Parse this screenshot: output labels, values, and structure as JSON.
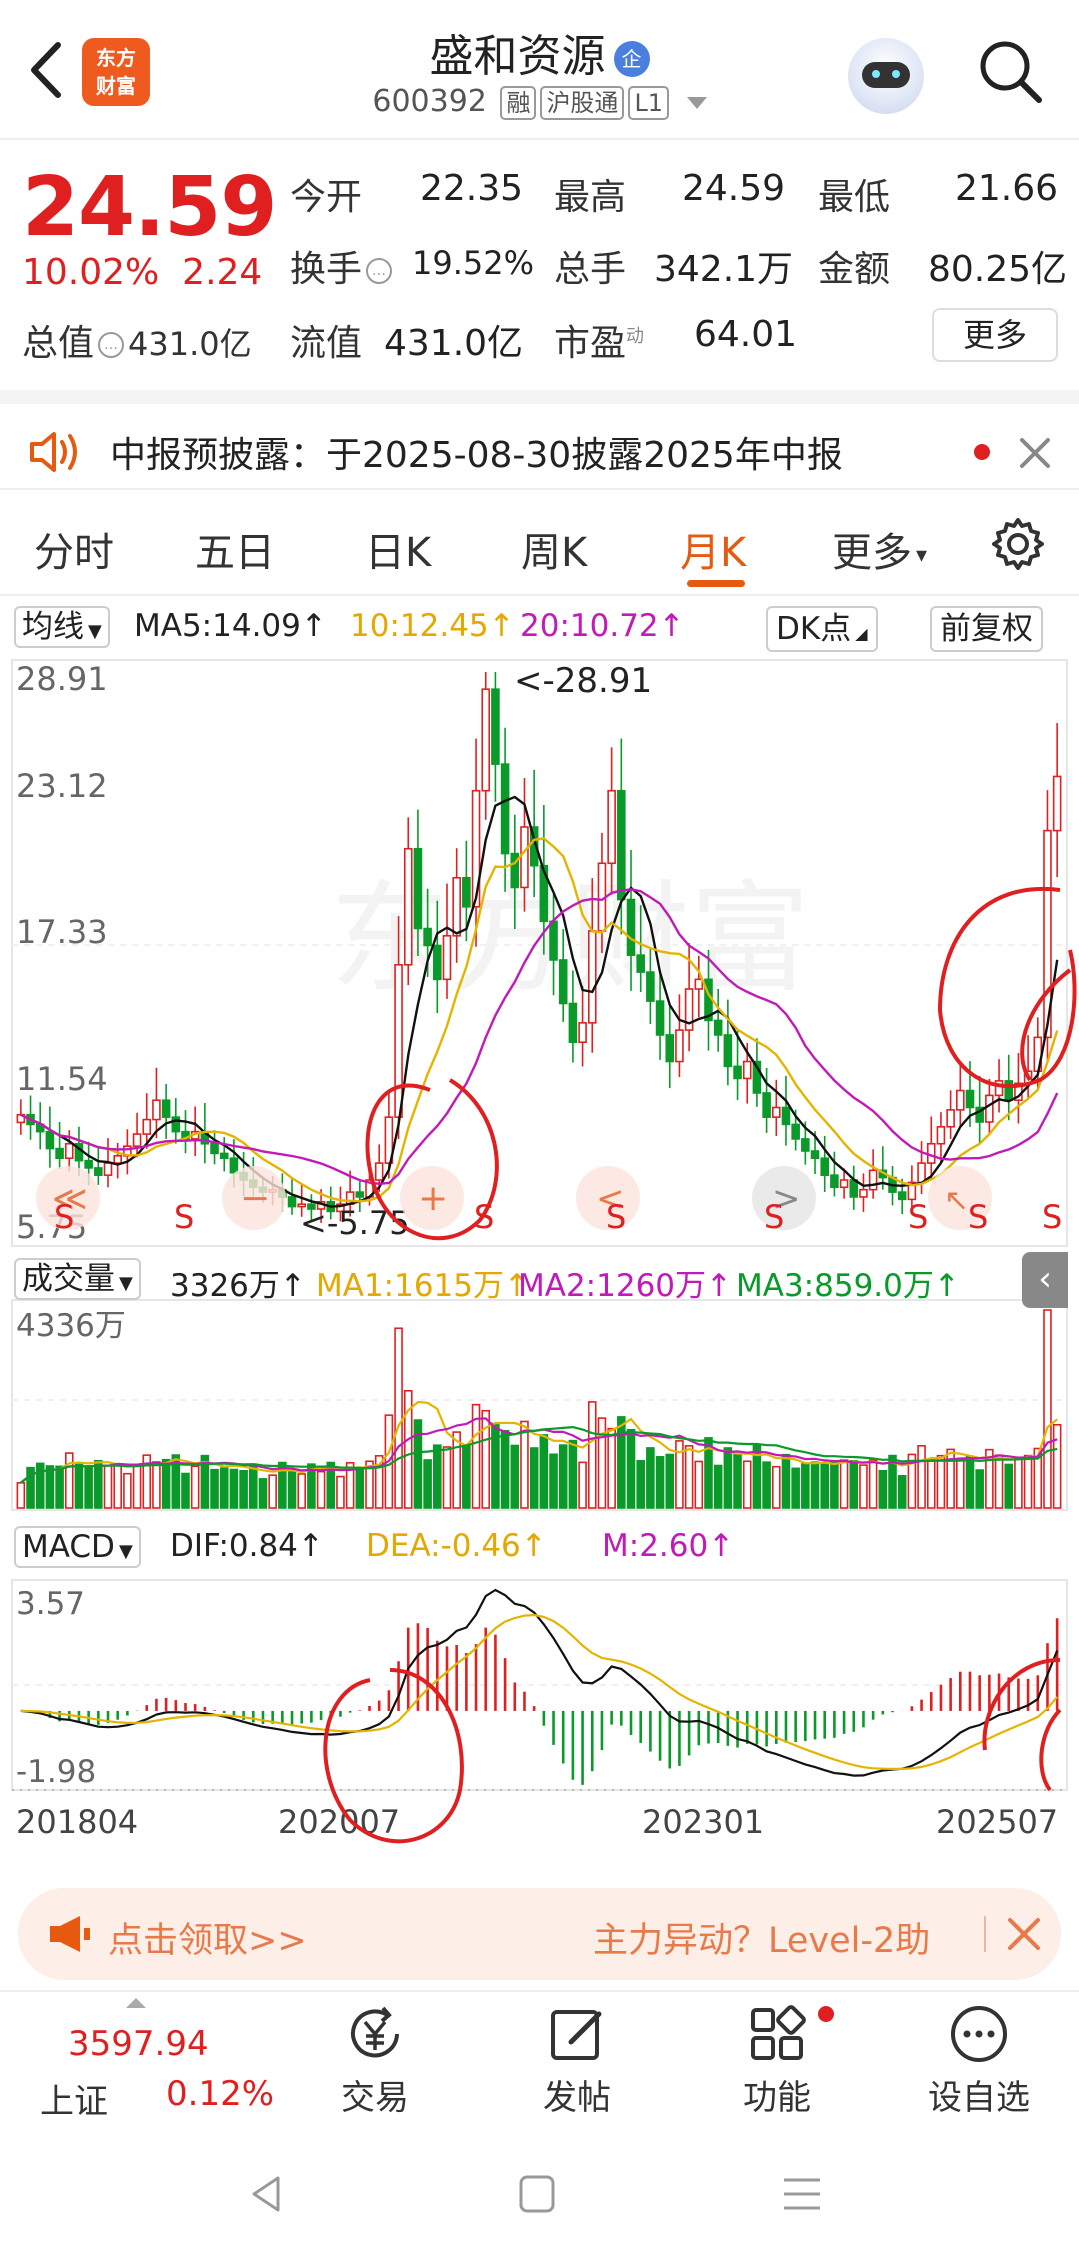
{
  "header": {
    "brand_logo": "东方\n财富",
    "stock_name": "盛和资源",
    "name_badge": "企",
    "code": "600392",
    "tags": [
      "融",
      "沪股通",
      "L1"
    ]
  },
  "quote": {
    "last_price": "24.59",
    "change_pct": "10.02%",
    "change_amt": "2.24",
    "mktcap_label": "总值",
    "mktcap_value": "431.0亿",
    "open_label": "今开",
    "open_value": "22.35",
    "high_label": "最高",
    "high_value": "24.59",
    "low_label": "最低",
    "low_value": "21.66",
    "turnover_label": "换手",
    "turnover_value": "19.52%",
    "volume_label": "总手",
    "volume_value": "342.1万",
    "amount_label": "金额",
    "amount_value": "80.25亿",
    "float_label": "流值",
    "float_value": "431.0亿",
    "pe_label": "市盈",
    "pe_sup": "动",
    "pe_value": "64.01",
    "more_label": "更多"
  },
  "notice": {
    "text": "中报预披露：于2025-08-30披露2025年中报"
  },
  "tabs": [
    {
      "label": "分时",
      "active": false
    },
    {
      "label": "五日",
      "active": false
    },
    {
      "label": "日K",
      "active": false
    },
    {
      "label": "周K",
      "active": false
    },
    {
      "label": "月K",
      "active": true
    },
    {
      "label": "更多",
      "active": false
    }
  ],
  "ma_row": {
    "selector": "均线",
    "ma5": "MA5:14.09↑",
    "ma10": "10:12.45↑",
    "ma20": "20:10.72↑",
    "dk_button": "DK点",
    "adjust_button": "前复权"
  },
  "volume_row": {
    "selector": "成交量",
    "vol": "3326万↑",
    "ma1": "MA1:1615万↑",
    "ma2": "MA2:1260万↑",
    "ma3": "MA3:859.0万↑"
  },
  "macd_row": {
    "selector": "MACD",
    "dif": "DIF:0.84↑",
    "dea": "DEA:-0.46↑",
    "m": "M:2.60↑"
  },
  "chart_data": {
    "type": "candlestick",
    "period": "monthly",
    "price_axis_labels": [
      "28.91",
      "23.12",
      "17.33",
      "11.54",
      "5.75"
    ],
    "price_range": [
      5.75,
      28.91
    ],
    "high_marker": "<-28.91",
    "low_marker": "<-5.75",
    "volume_axis_label": "4336万",
    "macd_axis_labels": [
      "3.57",
      "-1.98"
    ],
    "macd_range": [
      -1.98,
      3.57
    ],
    "date_labels": [
      "201804",
      "202007",
      "202301",
      "202507"
    ],
    "signal_marks": [
      "S",
      "S",
      "S",
      "S",
      "S",
      "S",
      "S",
      "S",
      "S"
    ],
    "colors": {
      "up": "#e02020",
      "down": "#0a9a2a",
      "ma5": "#111111",
      "ma10": "#e4b400",
      "ma20": "#c21ab8"
    },
    "monthly_close": [
      10.6,
      10.2,
      9.9,
      9.2,
      8.8,
      9.4,
      8.7,
      8.4,
      8.1,
      8.6,
      8.9,
      9.3,
      9.8,
      10.4,
      11.2,
      10.5,
      9.9,
      9.6,
      9.9,
      9.4,
      9.0,
      8.8,
      8.2,
      7.9,
      7.6,
      7.4,
      7.5,
      7.2,
      6.8,
      6.9,
      6.7,
      7.0,
      6.6,
      6.9,
      7.4,
      7.2,
      7.9,
      8.6,
      10.5,
      16.8,
      21.6,
      18.3,
      17.6,
      16.2,
      18.0,
      20.4,
      19.2,
      24.0,
      28.2,
      25.1,
      21.4,
      20.0,
      22.5,
      20.9,
      18.6,
      17.0,
      15.2,
      13.6,
      14.4,
      18.2,
      21.0,
      24.0,
      19.5,
      17.2,
      16.5,
      15.3,
      13.9,
      12.8,
      14.1,
      15.8,
      16.2,
      14.5,
      13.9,
      12.6,
      12.1,
      12.8,
      11.5,
      10.5,
      10.9,
      10.2,
      9.6,
      9.1,
      8.8,
      8.1,
      7.6,
      7.9,
      7.2,
      7.5,
      8.3,
      8.0,
      7.4,
      7.1,
      7.8,
      8.6,
      9.4,
      10.1,
      10.8,
      11.6,
      10.9,
      10.3,
      11.4,
      12.0,
      11.2,
      11.9,
      12.4,
      13.8,
      22.35,
      24.59
    ]
  },
  "banner": {
    "left_text": "点击领取>>",
    "right_text": "主力异动？Level-2助"
  },
  "bottom_bar": {
    "index_price": "3597.94",
    "index_name": "上证",
    "index_change": "0.12%",
    "nav": [
      {
        "label": "交易"
      },
      {
        "label": "发帖"
      },
      {
        "label": "功能"
      },
      {
        "label": "设自选"
      }
    ]
  }
}
